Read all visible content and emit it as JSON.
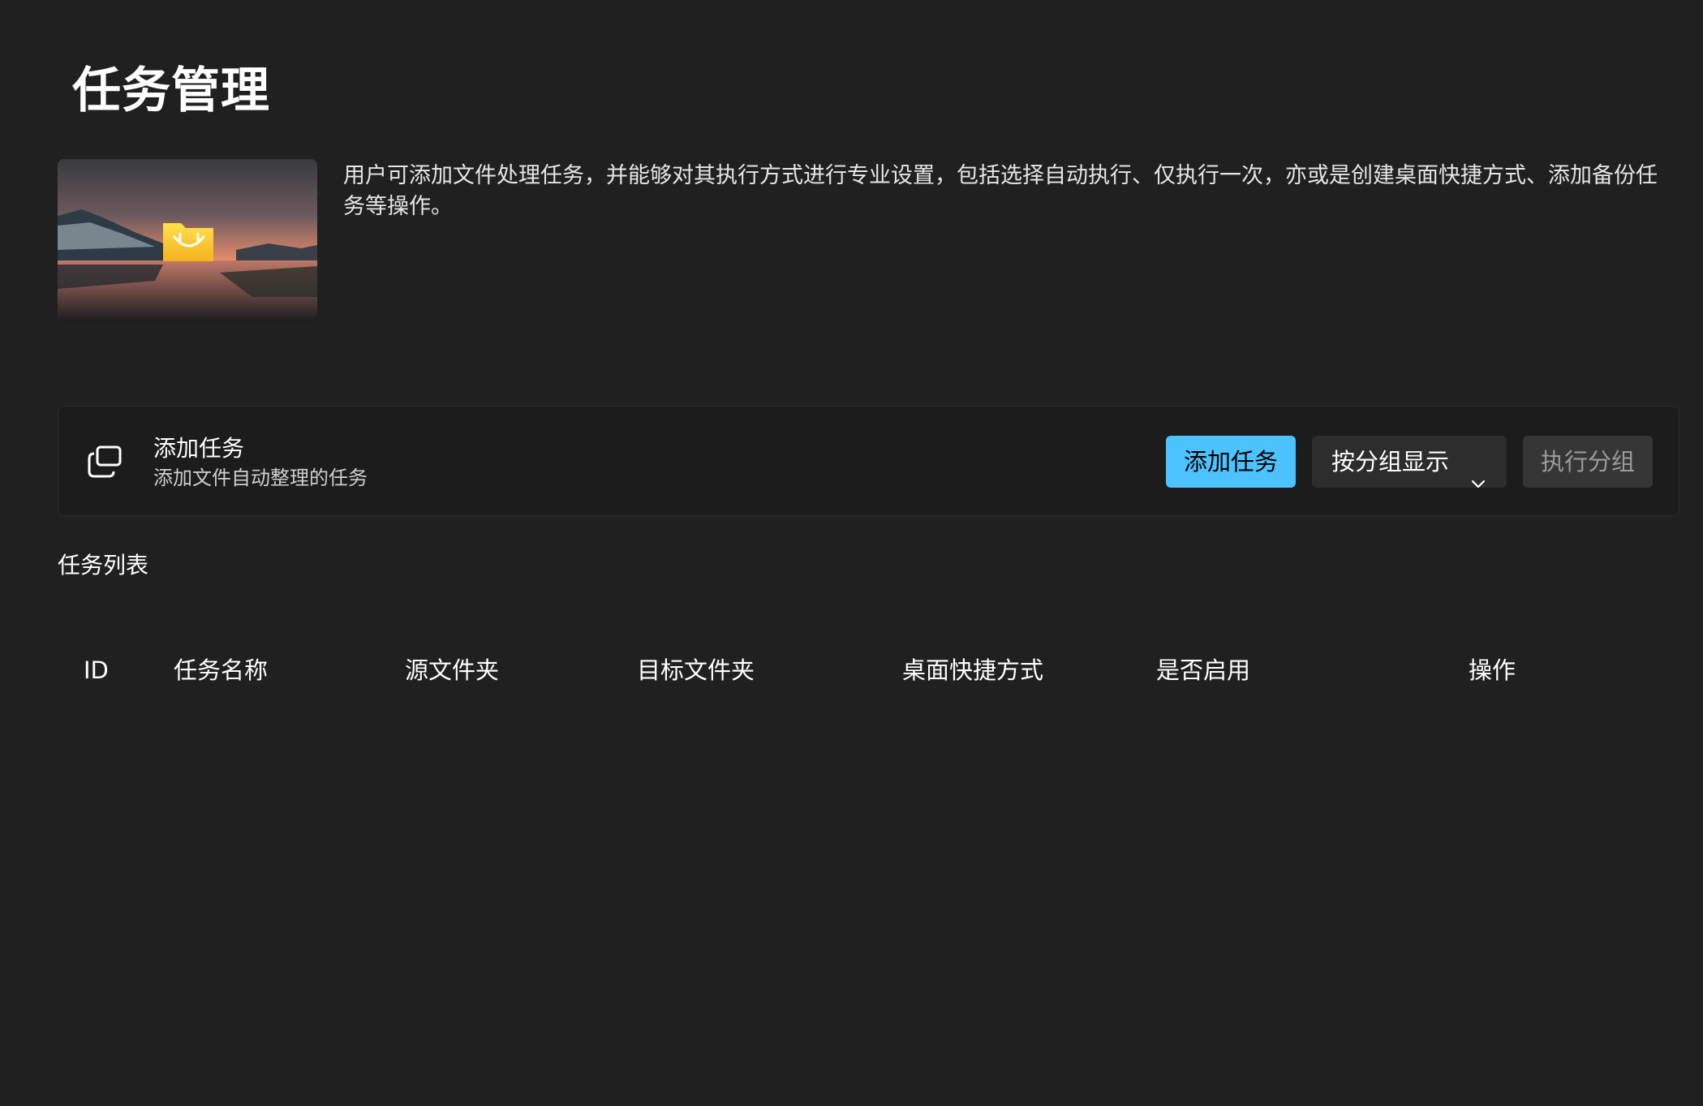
{
  "page": {
    "title": "任务管理",
    "description": "用户可添加文件处理任务，并能够对其执行方式进行专业设置，包括选择自动执行、仅执行一次，亦或是创建桌面快捷方式、添加备份任务等操作。"
  },
  "add_card": {
    "icon": "copy-windows-icon",
    "title": "添加任务",
    "subtitle": "添加文件自动整理的任务",
    "add_button_label": "添加任务",
    "group_dropdown_label": "按分组显示",
    "run_group_button_label": "执行分组"
  },
  "task_list": {
    "title": "任务列表",
    "columns": [
      "ID",
      "任务名称",
      "源文件夹",
      "目标文件夹",
      "桌面快捷方式",
      "是否启用",
      "操作"
    ],
    "rows": []
  },
  "colors": {
    "background": "#202020",
    "accent": "#4cc2ff",
    "card": "#1c1c1c"
  }
}
